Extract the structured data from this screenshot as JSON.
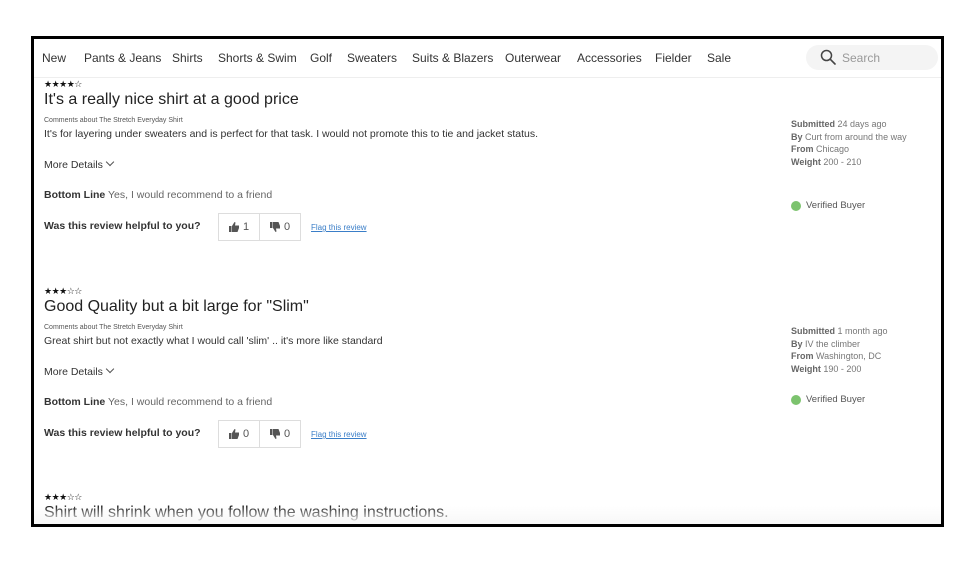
{
  "nav": {
    "items": [
      "New",
      "Pants & Jeans",
      "Shirts",
      "Shorts & Swim",
      "Golf",
      "Sweaters",
      "Suits & Blazers",
      "Outerwear",
      "Accessories",
      "Fielder",
      "Sale"
    ],
    "search_placeholder": "Search",
    "search_icon": "search-icon"
  },
  "reviews": [
    {
      "rating": 4,
      "stars": "★★★★☆",
      "title": "It's a really nice shirt at a good price",
      "comments_about": "Comments about The Stretch Everyday Shirt",
      "body": "It's for layering under sweaters and is perfect for that task. I would not promote this to tie and jacket status.",
      "more_details": "More Details",
      "bottom_line_label": "Bottom Line",
      "bottom_line": "Yes, I would recommend to a friend",
      "helpful_label": "Was this review helpful to you?",
      "helpful_up": "1",
      "helpful_down": "0",
      "flag": "Flag this review",
      "submitted_label": "Submitted",
      "submitted": "24 days ago",
      "by_label": "By",
      "by": "Curt from around the way",
      "from_label": "From",
      "from": "Chicago",
      "weight_label": "Weight",
      "weight": "200 - 210",
      "verified": "Verified Buyer"
    },
    {
      "rating": 3,
      "stars": "★★★☆☆",
      "title": "Good Quality but a bit large for \"Slim\"",
      "comments_about": "Comments about The Stretch Everyday Shirt",
      "body": "Great shirt but not exactly what I would call 'slim' .. it's more like standard",
      "more_details": "More Details",
      "bottom_line_label": "Bottom Line",
      "bottom_line": "Yes, I would recommend to a friend",
      "helpful_label": "Was this review helpful to you?",
      "helpful_up": "0",
      "helpful_down": "0",
      "flag": "Flag this review",
      "submitted_label": "Submitted",
      "submitted": "1 month ago",
      "by_label": "By",
      "by": "IV the climber",
      "from_label": "From",
      "from": "Washington, DC",
      "weight_label": "Weight",
      "weight": "190 - 200",
      "verified": "Verified Buyer"
    },
    {
      "rating": 3,
      "stars": "★★★☆☆",
      "title": "Shirt will shrink when you follow the washing instructions."
    }
  ],
  "colors": {
    "link": "#3a7ec8",
    "verified": "#7cc36e"
  }
}
